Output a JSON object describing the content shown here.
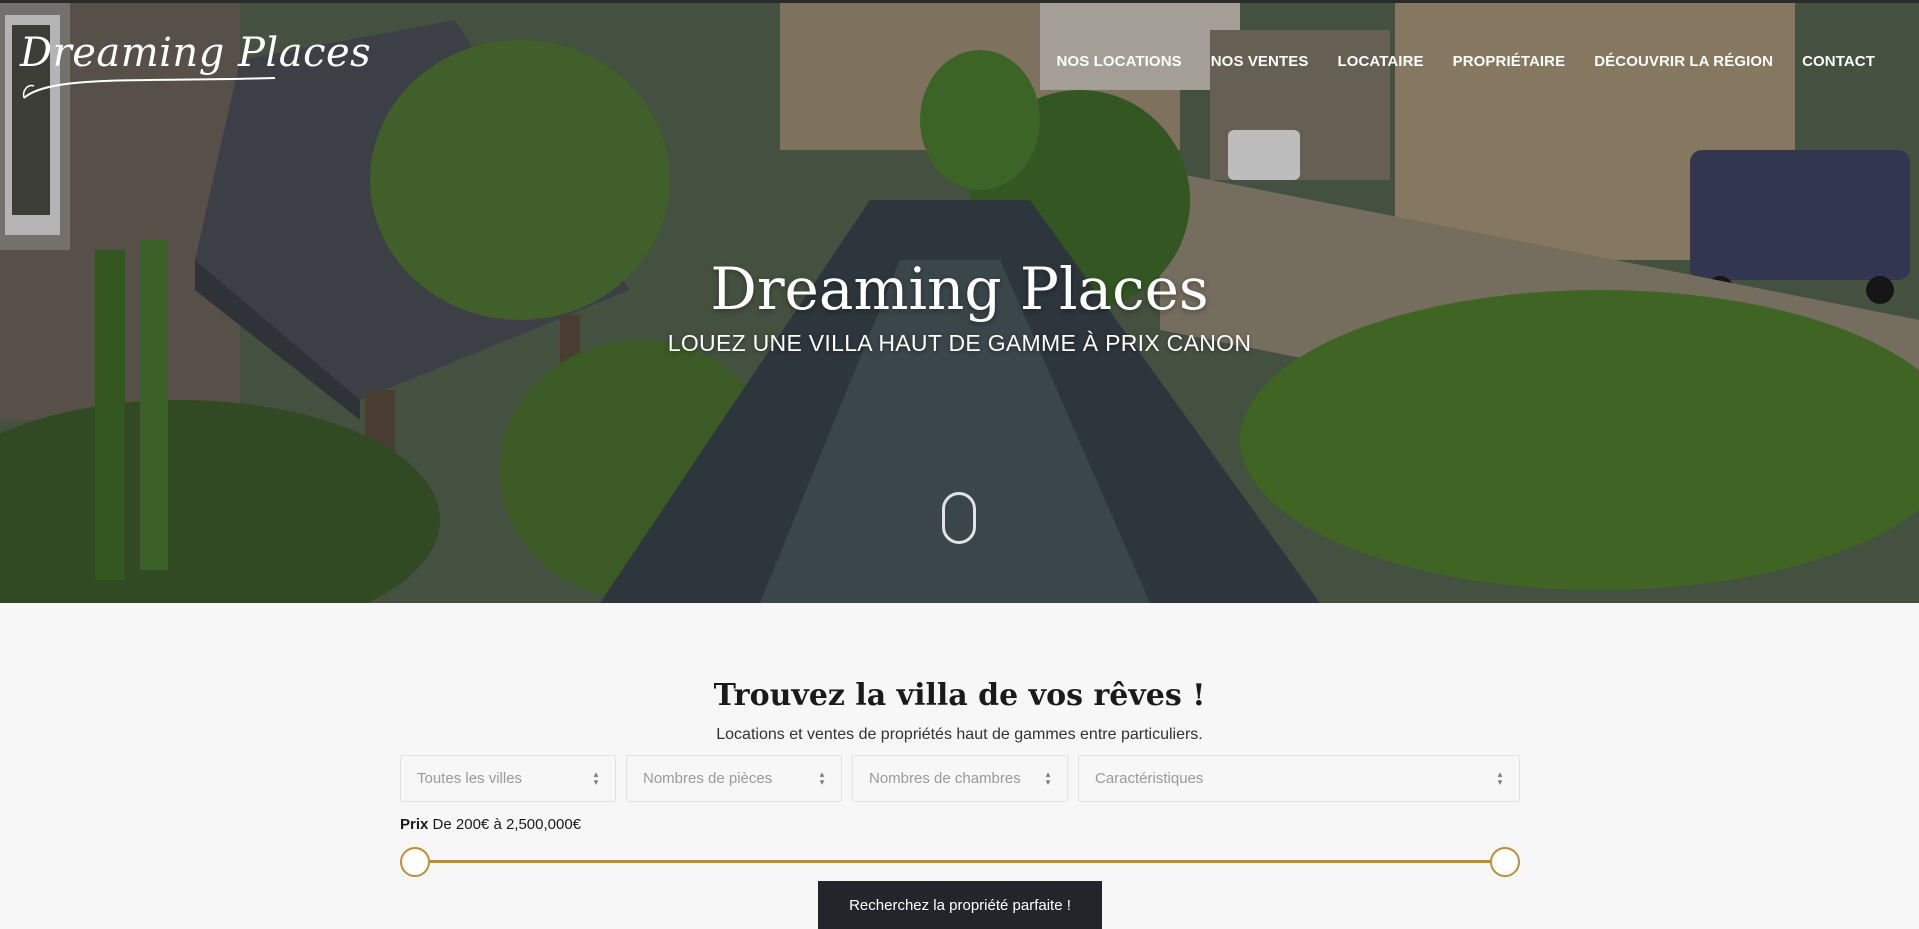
{
  "brand": {
    "logo_text": "Dreaming Places"
  },
  "nav": {
    "items": [
      {
        "label": "NOS LOCATIONS"
      },
      {
        "label": "NOS VENTES"
      },
      {
        "label": "LOCATAIRE"
      },
      {
        "label": "PROPRIÉTAIRE"
      },
      {
        "label": "DÉCOUVRIR LA RÉGION"
      },
      {
        "label": "CONTACT"
      }
    ]
  },
  "hero": {
    "title": "Dreaming Places",
    "subtitle": "LOUEZ UNE VILLA HAUT DE GAMME À PRIX CANON",
    "scroll_icon": "mouse-scroll-icon"
  },
  "search": {
    "title": "Trouvez la villa de vos rêves !",
    "description": "Locations et ventes de propriétés haut de gammes entre particuliers.",
    "filters": {
      "city": "Toutes les villes",
      "rooms": "Nombres de pièces",
      "bedrooms": "Nombres de chambres",
      "features": "Caractéristiques"
    },
    "price": {
      "label": "Prix",
      "from_word": "De",
      "min": "200€",
      "to_word": "à",
      "max": "2,500,000€",
      "min_fraction": 0,
      "max_fraction": 1
    },
    "button": "Recherchez la propriété parfaite !"
  },
  "colors": {
    "accent": "#b89040",
    "button_bg": "#22262b",
    "section_bg": "#f7f7f7"
  }
}
